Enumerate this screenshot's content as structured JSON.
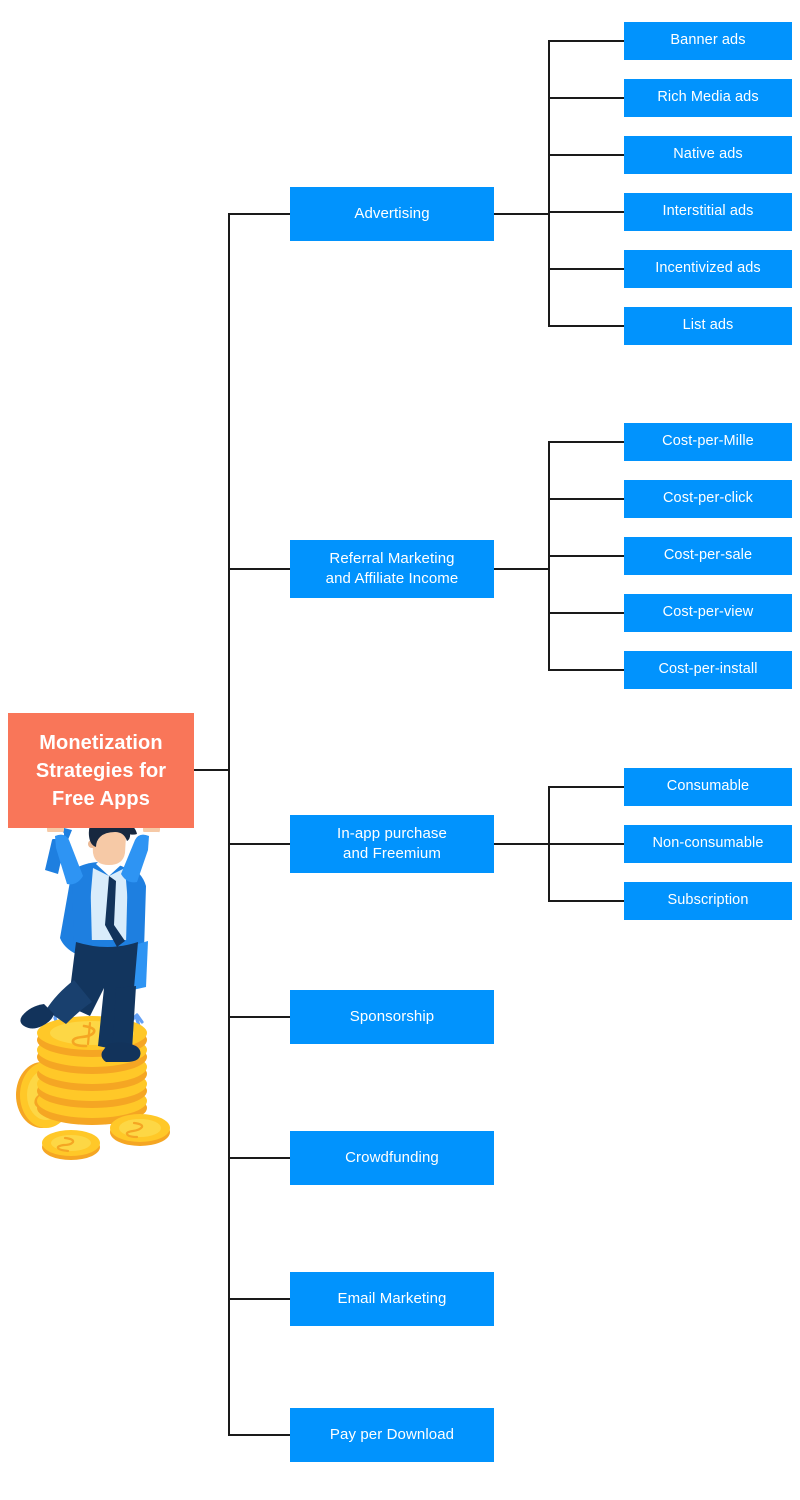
{
  "diagram": {
    "type": "mind-map",
    "title": "Monetization Strategies for Free Apps",
    "colors": {
      "root": "#f97659",
      "node": "#0193fd",
      "connector": "#1a1a1a",
      "text": "#ffffff",
      "background": "#ffffff"
    },
    "root": {
      "label": "Monetization\nStrategies for\nFree Apps",
      "line1": "Monetization",
      "line2": "Strategies for",
      "line3": "Free Apps"
    },
    "branches": [
      {
        "label": "Advertising",
        "children": [
          "Banner ads",
          "Rich Media ads",
          "Native ads",
          "Interstitial ads",
          "Incentivized ads",
          "List ads"
        ]
      },
      {
        "label": "Referral Marketing\nand Affiliate Income",
        "line1": "Referral Marketing",
        "line2": "and Affiliate Income",
        "children": [
          "Cost-per-Mille",
          "Cost-per-click",
          "Cost-per-sale",
          "Cost-per-view",
          "Cost-per-install"
        ]
      },
      {
        "label": "In-app purchase\nand Freemium",
        "line1": "In-app purchase",
        "line2": "and Freemium",
        "children": [
          "Consumable",
          "Non-consumable",
          "Subscription"
        ]
      },
      {
        "label": "Sponsorship",
        "children": []
      },
      {
        "label": "Crowdfunding",
        "children": []
      },
      {
        "label": "Email Marketing",
        "children": []
      },
      {
        "label": "Pay per Download",
        "children": []
      }
    ],
    "illustration": {
      "name": "businessman-holding-sign-on-coin-stack",
      "description": "Flat illustration of a businessman in a blue suit holding up the title sign while standing on a stack of gold dollar coins with upward blue arrows"
    }
  }
}
